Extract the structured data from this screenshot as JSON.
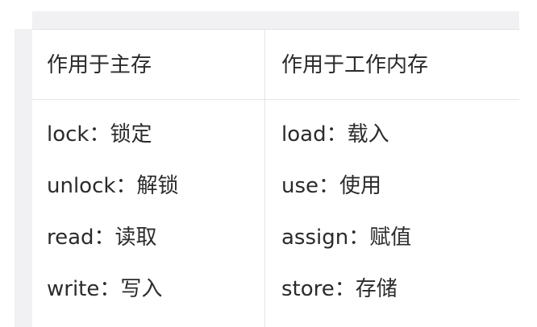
{
  "table": {
    "headers": [
      "作用于主存",
      "作用于工作内存"
    ],
    "rows": [
      [
        "lock：锁定",
        "load：载入"
      ],
      [
        "unlock：解锁",
        "use：使用"
      ],
      [
        "read：读取",
        "assign：赋值"
      ],
      [
        "write：写入",
        "store：存储"
      ]
    ]
  }
}
